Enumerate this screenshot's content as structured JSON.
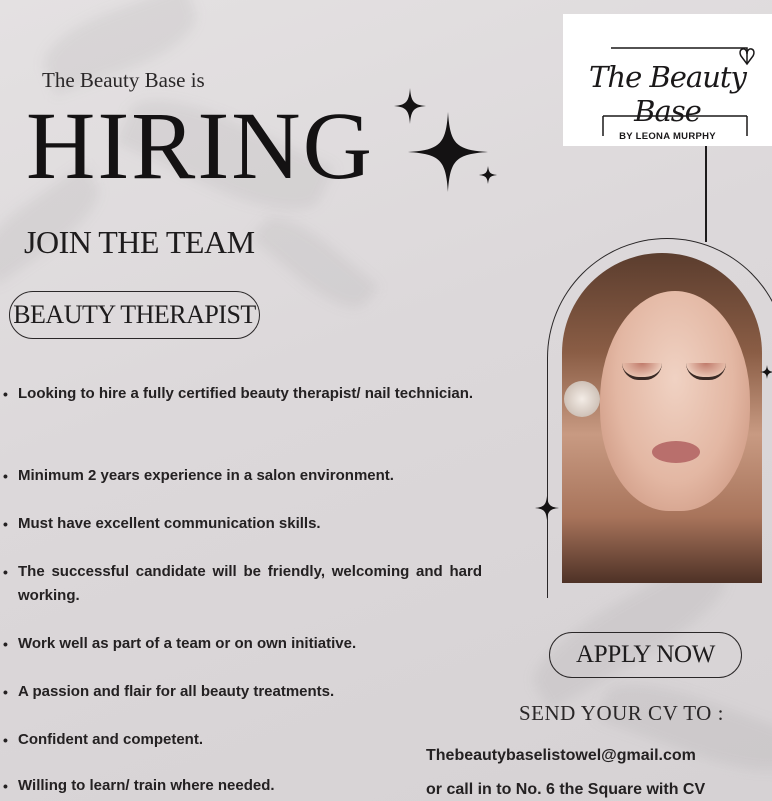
{
  "header": {
    "intro": "The Beauty Base is",
    "headline": "HIRING",
    "subheadline": "JOIN THE TEAM",
    "role": "BEAUTY THERAPIST"
  },
  "logo": {
    "script_text": "The Beauty Base",
    "tagline": "BY LEONA MURPHY"
  },
  "requirements": [
    "Looking to hire a fully certified beauty therapist/ nail technician.",
    "Minimum 2 years experience in a salon environment.",
    "Must have excellent communication skills.",
    "The successful candidate will be friendly, welcoming and hard working.",
    "Work well as part of a team or on own initiative.",
    "A passion and flair for all beauty treatments.",
    "Confident and competent.",
    "Willing to learn/ train where needed."
  ],
  "cta": {
    "apply_label": "APPLY NOW",
    "send_label": "SEND YOUR CV TO :",
    "email": "Thebeautybaselistowel@gmail.com",
    "address_line": "or call in to No. 6 the Square with CV"
  },
  "icons": {
    "sparkles": "sparkle-stars-icon",
    "small_star": "four-point-star-icon"
  },
  "colors": {
    "background": "#dcd8da",
    "text": "#1d1b1c",
    "logo_background": "#ffffff"
  }
}
